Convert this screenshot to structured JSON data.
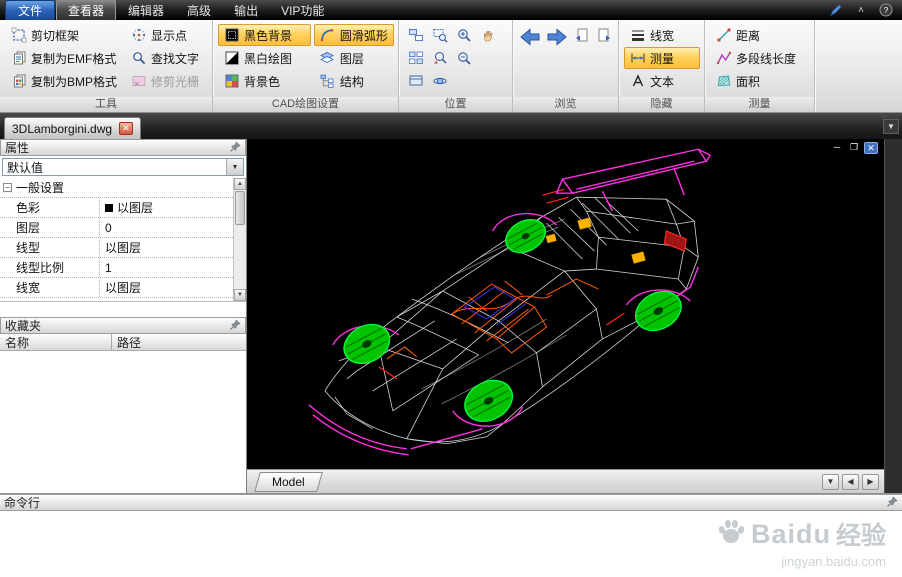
{
  "colors": {
    "ribbon_highlight": "#ffd25e",
    "canvas_background": "#000000",
    "wheel_green": "#00cc00",
    "trim_magenta": "#ff2ee0",
    "cage_orange": "#ff5a00",
    "watermark_gray": "#c6cbd0"
  },
  "titlebar": {
    "file_menu": "文件",
    "tabs": [
      "查看器",
      "编辑器",
      "高级",
      "输出",
      "VIP功能"
    ]
  },
  "ribbon": {
    "tools": {
      "label": "工具",
      "crop": {
        "label": "剪切框架",
        "icon": "crop-frame-icon"
      },
      "copy_emf": {
        "label": "复制为EMF格式",
        "icon": "copy-emf-icon"
      },
      "copy_bmp": {
        "label": "复制为BMP格式",
        "icon": "copy-bmp-icon"
      },
      "show_points": {
        "label": "显示点",
        "icon": "show-points-icon"
      },
      "find_text": {
        "label": "查找文字",
        "icon": "find-text-icon"
      },
      "trim_raster": {
        "label": "修剪光栅",
        "icon": "trim-raster-icon",
        "disabled": true
      }
    },
    "cad": {
      "label": "CAD绘图设置",
      "black_bg": {
        "label": "黑色背景",
        "icon": "black-background-icon",
        "active": true
      },
      "smooth_arc": {
        "label": "圆滑弧形",
        "icon": "smooth-arc-icon",
        "active": true
      },
      "bw": {
        "label": "黑白绘图",
        "icon": "bw-drawing-icon"
      },
      "layers": {
        "label": "图层",
        "icon": "layers-icon"
      },
      "bg_color": {
        "label": "背景色",
        "icon": "background-color-icon"
      },
      "structure": {
        "label": "结构",
        "icon": "structure-icon"
      }
    },
    "position": {
      "label": "位置",
      "icons": [
        "window-pan-icon",
        "zoom-window-icon",
        "zoom-in-icon",
        "hand-pan-icon",
        "window-tile-icon",
        "zoom-previous-icon",
        "zoom-out-icon",
        "named-views-icon",
        "orbit-3d-icon"
      ]
    },
    "browse": {
      "label": "浏览",
      "icons": [
        "back-arrow-icon",
        "forward-arrow-icon",
        "page-back-icon",
        "page-forward-icon"
      ]
    },
    "hide": {
      "label": "隐藏",
      "linewidth": {
        "label": "线宽",
        "icon": "lineweight-icon"
      },
      "measure": {
        "label": "测量",
        "icon": "measure-toggle-icon",
        "active": true
      },
      "text": {
        "label": "文本",
        "icon": "text-icon"
      }
    },
    "measure": {
      "label": "测量",
      "distance": {
        "label": "距离",
        "icon": "distance-icon"
      },
      "polyline": {
        "label": "多段线长度",
        "icon": "polyline-length-icon"
      },
      "area": {
        "label": "面积",
        "icon": "area-icon"
      }
    }
  },
  "document": {
    "tab": "3DLamborgini.dwg"
  },
  "properties": {
    "title": "属性",
    "preset": "默认值",
    "group": "一般设置",
    "rows": [
      {
        "label": "色彩",
        "value": "以图层",
        "swatch": "#000000"
      },
      {
        "label": "图层",
        "value": "0"
      },
      {
        "label": "线型",
        "value": "以图层"
      },
      {
        "label": "线型比例",
        "value": "1"
      },
      {
        "label": "线宽",
        "value": "以图层"
      }
    ]
  },
  "favorites": {
    "title": "收藏夹",
    "columns": [
      "名称",
      "路径"
    ]
  },
  "viewport": {
    "model_tab": "Model"
  },
  "command": {
    "title": "命令行"
  },
  "watermark": {
    "brand": "Baidu",
    "suffix": "经验",
    "url": "jingyan.baidu.com"
  }
}
